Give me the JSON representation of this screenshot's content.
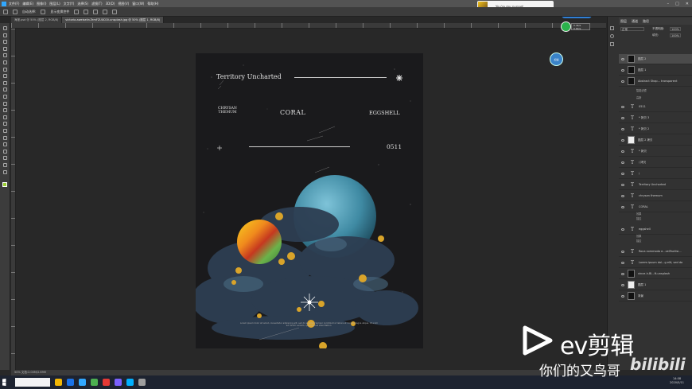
{
  "menubar": {
    "items": [
      "文件(F)",
      "编辑(E)",
      "图像(I)",
      "图层(L)",
      "文字(Y)",
      "选择(S)",
      "滤镜(T)",
      "3D(D)",
      "视图(V)",
      "窗口(W)",
      "帮助(H)"
    ]
  },
  "optionsbar": {
    "auto_select": "自动选择:",
    "show_transform": "显示变换控件"
  },
  "tabs": [
    {
      "label": "海报.psd @ 50% (图层 2, RGB/8)",
      "active": false
    },
    {
      "label": "victoria-aweiselin-TemFZUXC00-unsplash.jpg @ 50% (图层 1, RGB/8)",
      "active": true
    }
  ],
  "notification": {
    "title": "You're my puppet"
  },
  "qq_pill": "已加速",
  "net_badge": {
    "up": "0.4K/s",
    "down": "0.6K/s"
  },
  "blue_button": "加速",
  "poster": {
    "title": "Territory  Uncharted",
    "left_word_line1": "CHRYSAN",
    "left_word_line2": "THEMUM",
    "center_word": "CORAL",
    "right_word": "EGGSHELL",
    "number": "0511",
    "small_paragraph": "Lorem ipsum dolor sit amet, consectetur adipiscing elit, sed do eiusmod tempor incididunt ut labore et dolore magna aliqua. Ut enim ad minim veniam, quis nostrud exercitation."
  },
  "panels": {
    "header_tabs": [
      "图层",
      "通道",
      "路径"
    ],
    "opacity_label": "不透明度:",
    "opacity_value": "100%",
    "fill_label": "填充:",
    "fill_value": "100%",
    "blend_mode": "正常"
  },
  "layers": [
    {
      "kind": "thumb",
      "name": "图层 2",
      "selected": true
    },
    {
      "kind": "thumb",
      "name": "图层 1",
      "selected": false
    },
    {
      "kind": "thumb",
      "name": "Abstract Shap... transparent",
      "selected": false
    },
    {
      "kind": "T",
      "name": "0511",
      "selected": false
    },
    {
      "kind": "T",
      "name": "* 拷贝 3",
      "selected": false
    },
    {
      "kind": "T",
      "name": "* 拷贝 2",
      "selected": false
    },
    {
      "kind": "thumb",
      "name": "图层 2 拷贝",
      "selected": false
    },
    {
      "kind": "T",
      "name": "* 拷贝",
      "selected": false
    },
    {
      "kind": "T",
      "name": "/ 拷贝",
      "selected": false
    },
    {
      "kind": "T",
      "name": "/",
      "selected": false
    },
    {
      "kind": "T",
      "name": "Territory Uncharted",
      "selected": false
    },
    {
      "kind": "T",
      "name": "chrysan themum",
      "selected": false
    },
    {
      "kind": "T",
      "name": "CORAL",
      "selected": false
    },
    {
      "kind": "T",
      "name": "eggshell",
      "selected": false
    },
    {
      "kind": "T",
      "name": "Roca commodo e...velFacilisi...",
      "selected": false
    },
    {
      "kind": "T",
      "name": "Lorem ipsum dol...g elit, sed do",
      "selected": false
    },
    {
      "kind": "thumb",
      "name": "vince-h-Bl...ft-unsplash",
      "selected": false
    },
    {
      "kind": "thumb",
      "name": "图层 1",
      "selected": false
    },
    {
      "kind": "thumb",
      "name": "背景",
      "selected": false
    }
  ],
  "layer_sub": {
    "mask_label": "智能滤镜",
    "filter": "高斯",
    "effects": "效果",
    "stroke": "描边"
  },
  "status": "50%   文档:2.00M/2.69M",
  "clock": {
    "time": "14:08",
    "date": "2020/5/11"
  },
  "watermark": {
    "ev_text": "ev剪辑",
    "sub_text": "你们的又鸟哥",
    "bili": "bilibili"
  },
  "colors": {
    "accent_blue": "#31a8ff",
    "poster_bg": "#1a1a1c",
    "planet_blue": "#4a90a8"
  }
}
